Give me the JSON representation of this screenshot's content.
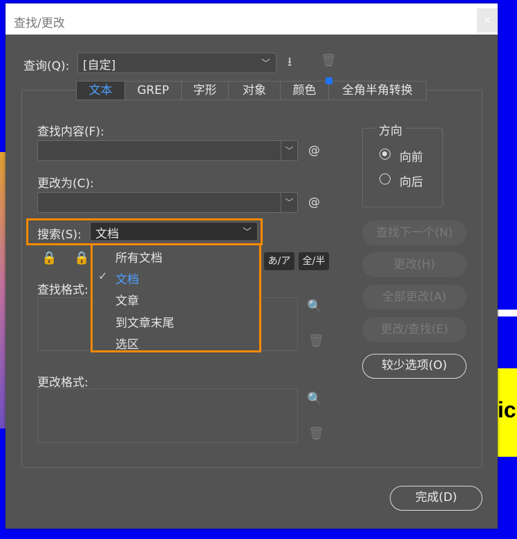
{
  "window": {
    "title": "查找/更改",
    "close": "×"
  },
  "query": {
    "label": "查询(Q):",
    "value": "[自定]"
  },
  "tabs": [
    {
      "label": "文本"
    },
    {
      "label": "GREP"
    },
    {
      "label": "字形"
    },
    {
      "label": "对象"
    },
    {
      "label": "颜色"
    },
    {
      "label": "全角半角转换"
    }
  ],
  "find": {
    "label": "查找内容(F):",
    "value": "",
    "special": "@"
  },
  "change": {
    "label": "更改为(C):",
    "value": "",
    "special": "@"
  },
  "direction": {
    "title": "方向",
    "forward": "向前",
    "backward": "向后",
    "selected": "向前"
  },
  "search": {
    "label": "搜索(S):",
    "value": "文档",
    "options": [
      "所有文档",
      "文档",
      "文章",
      "到文章末尾",
      "选区"
    ],
    "check": "✓"
  },
  "toggles": {
    "kana": "あ/ア",
    "width": "全/半"
  },
  "find_format": {
    "label": "查找格式:"
  },
  "change_format": {
    "label": "更改格式:"
  },
  "buttons": {
    "find_next": "查找下一个(N)",
    "change": "更改(H)",
    "change_all": "全部更改(A)",
    "change_find": "更改/查找(E)",
    "fewer": "较少选项(O)",
    "done": "完成(D)"
  },
  "background": {
    "text": "ic"
  },
  "colors": {
    "accent": "#4ea0ff",
    "highlight": "#ff8a00",
    "dialog": "#535353"
  }
}
